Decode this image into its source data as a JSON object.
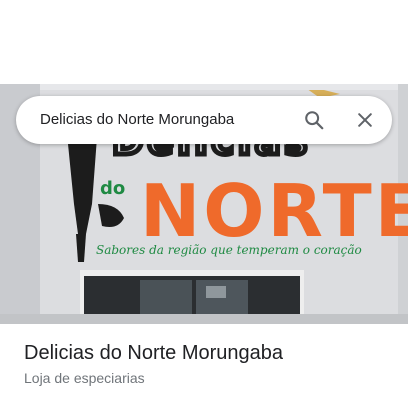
{
  "search": {
    "query": "Delicias do Norte Morungaba"
  },
  "photo": {
    "sign_line_1": "Delicias",
    "sign_small": "do",
    "sign_line_2": "NORTE",
    "slogan": "Sabores da região que temperam o coração"
  },
  "place": {
    "name": "Delicias do Norte Morungaba",
    "category": "Loja de especiarias"
  },
  "colors": {
    "sign_orange": "#ef6a2b",
    "sign_green": "#1f8a43",
    "sign_black": "#1c1c1c"
  },
  "icons": {
    "search": "search-icon",
    "close": "close-icon"
  }
}
